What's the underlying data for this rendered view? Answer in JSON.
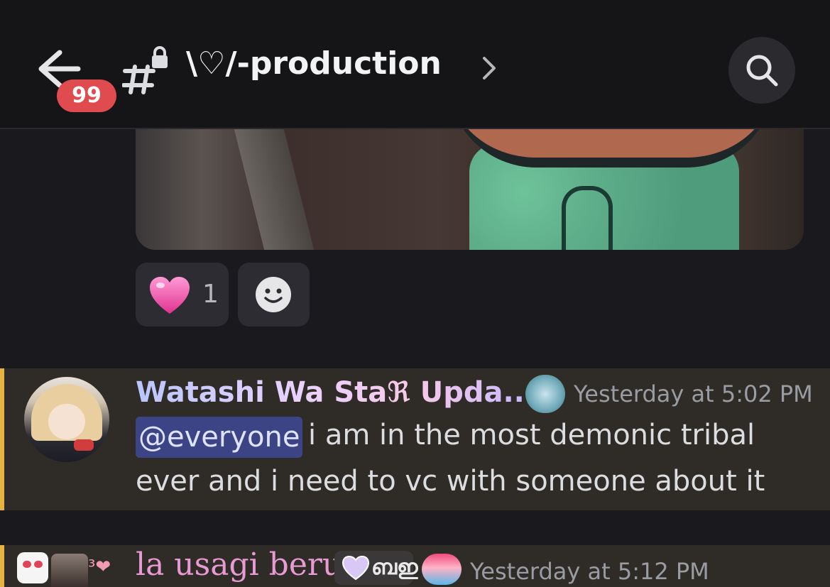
{
  "header": {
    "back_icon": "back-arrow-icon",
    "unread_badge": "99",
    "channel_icon": "locked-hashtag-icon",
    "channel_name": "\\♡/-production",
    "chevron_icon": "chevron-right-icon",
    "search_icon": "search-icon"
  },
  "attachment": {
    "type": "image"
  },
  "reactions": [
    {
      "emoji": "pink-heart-emoji",
      "count": "1"
    }
  ],
  "add_reaction_icon": "add-reaction-smiley-icon",
  "messages": [
    {
      "username": "Watashi Wa Staℜ Upda...",
      "role_icon": "character-role-icon",
      "timestamp": "Yesterday at 5:02 PM",
      "mention": "@everyone",
      "text_line1": "i am in the most demonic tribal",
      "text_line2": "ever and i need to vc with someone about it",
      "highlighted": true
    },
    {
      "username": "la usagi beru",
      "role_tag_text": "ബഇ",
      "role_tag_icon": "lavender-heart-icon",
      "role_icon": "stardew-role-icon",
      "timestamp": "Yesterday at 5:12 PM",
      "decoration": "³❤"
    }
  ],
  "colors": {
    "background": "#1a1a1e",
    "header": "#151518",
    "badge": "#e04b4f",
    "mention_bg": "#3d4486",
    "highlight_bar": "#e6b13f",
    "highlight_bg": "#2f2b26"
  }
}
